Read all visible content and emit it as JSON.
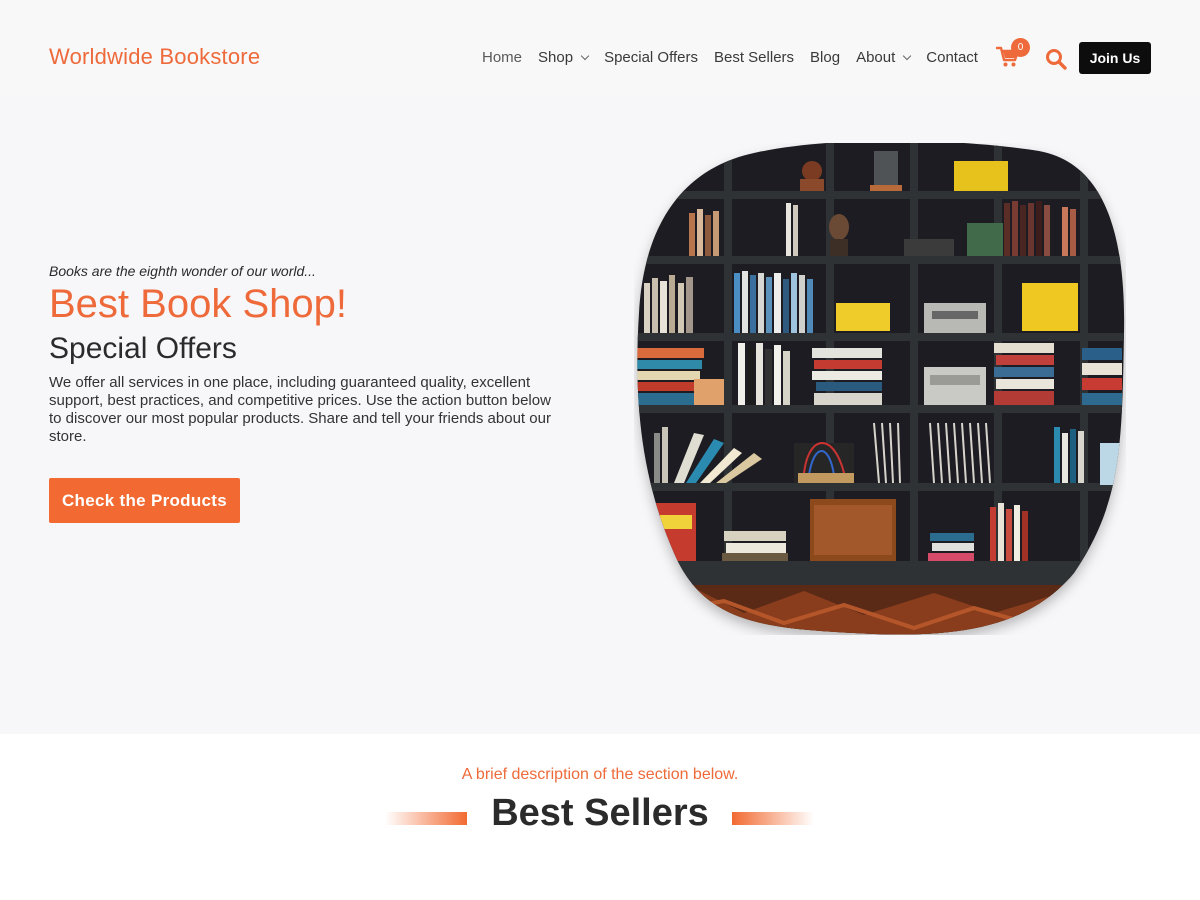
{
  "header": {
    "logo": "Worldwide Bookstore",
    "nav": [
      {
        "label": "Home",
        "dropdown": false
      },
      {
        "label": "Shop",
        "dropdown": true
      },
      {
        "label": "Special Offers",
        "dropdown": false
      },
      {
        "label": "Best Sellers",
        "dropdown": false
      },
      {
        "label": "Blog",
        "dropdown": false
      },
      {
        "label": "About",
        "dropdown": true
      },
      {
        "label": "Contact",
        "dropdown": false
      }
    ],
    "cart_count": "0",
    "join_label": "Join Us",
    "icons": {
      "cart": "shopping-cart-icon",
      "search": "search-icon"
    }
  },
  "hero": {
    "tagline": "Books are the eighth wonder of our world...",
    "title": "Best Book Shop!",
    "subtitle": "Special Offers",
    "description": "We offer all services in one place, including guaranteed quality, excellent support, best practices, and competitive prices. Use the action button below to discover our most popular products. Share and tell your friends about our store.",
    "cta_label": "Check the Products"
  },
  "section": {
    "description": "A brief description of the section below.",
    "title": "Best Sellers"
  },
  "colors": {
    "accent": "#ee6a3a",
    "button": "#f26a32",
    "dark": "#0d0d0d",
    "hero_bg": "#f7f7f9"
  }
}
